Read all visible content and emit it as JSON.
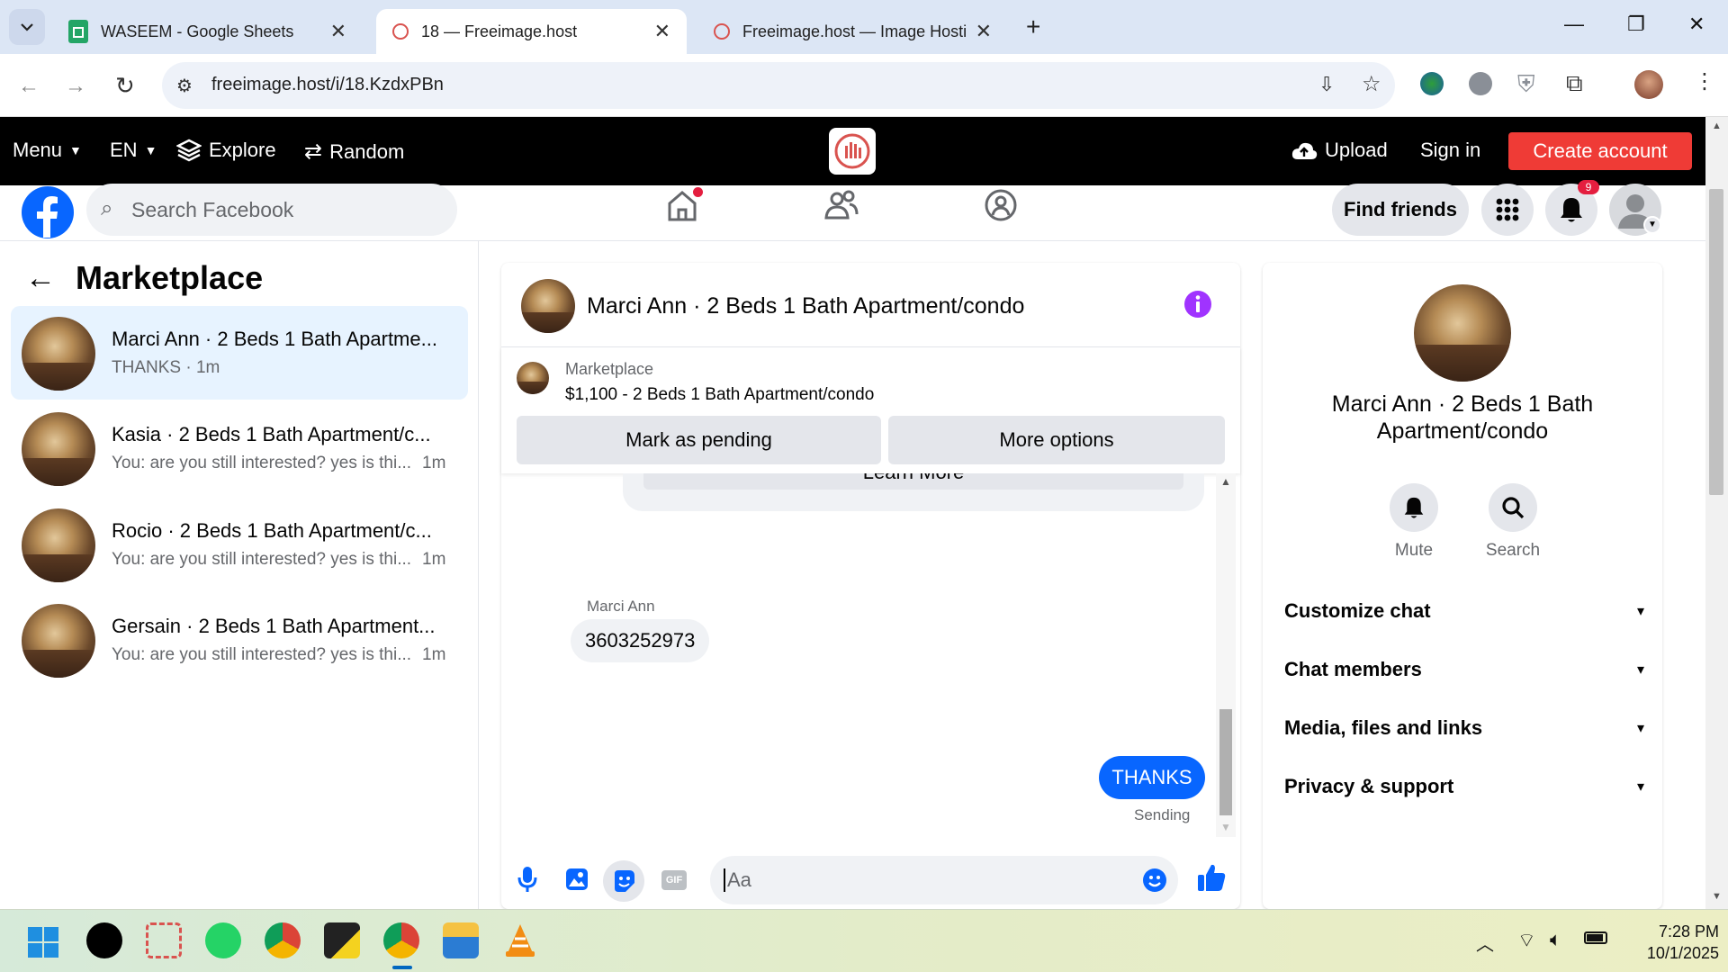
{
  "browser": {
    "tabs": [
      {
        "title": "WASEEM - Google Sheets",
        "active": false
      },
      {
        "title": "18 — Freeimage.host",
        "active": true
      },
      {
        "title": "Freeimage.host — Image Hostin",
        "active": false
      }
    ],
    "url": "freeimage.host/i/18.KzdxPBn"
  },
  "freeimage": {
    "menu": "Menu",
    "lang": "EN",
    "explore": "Explore",
    "random": "Random",
    "upload": "Upload",
    "signin": "Sign in",
    "create": "Create account"
  },
  "facebook": {
    "search_placeholder": "Search Facebook",
    "find_friends": "Find friends",
    "notif_badge": "9"
  },
  "marketplace": {
    "title": "Marketplace",
    "conversations": [
      {
        "name": "Marci Ann · 2 Beds 1 Bath Apartme...",
        "preview": "THANKS · 1m",
        "time": ""
      },
      {
        "name": "Kasia · 2 Beds 1 Bath Apartment/c...",
        "preview": "You: are you still interested? yes is thi...",
        "time": "1m"
      },
      {
        "name": "Rocio · 2 Beds 1 Bath Apartment/c...",
        "preview": "You: are you still interested? yes is thi...",
        "time": "1m"
      },
      {
        "name": "Gersain · 2 Beds 1 Bath Apartment...",
        "preview": "You: are you still interested? yes is thi...",
        "time": "1m"
      }
    ]
  },
  "chat": {
    "header_title": "Marci Ann · 2 Beds 1 Bath Apartment/condo",
    "listing_source": "Marketplace",
    "listing_title": "$1,100 - 2 Beds 1 Bath Apartment/condo",
    "mark_pending": "Mark as pending",
    "more_options": "More options",
    "learn_more": "Learn More",
    "incoming_sender": "Marci Ann",
    "incoming_text": "3603252973",
    "outgoing_text": "THANKS",
    "outgoing_status": "Sending",
    "input_placeholder": "Aa",
    "gif_label": "GIF"
  },
  "details": {
    "name": "Marci Ann · 2 Beds 1 Bath Apartment/condo",
    "mute": "Mute",
    "search": "Search",
    "sections": [
      "Customize chat",
      "Chat members",
      "Media, files and links",
      "Privacy & support"
    ]
  },
  "taskbar": {
    "time": "7:28 PM",
    "date": "10/1/2025"
  },
  "colors": {
    "fb_blue": "#0866ff",
    "messenger_purple": "#a033ff",
    "create_red": "#ef3b36"
  }
}
